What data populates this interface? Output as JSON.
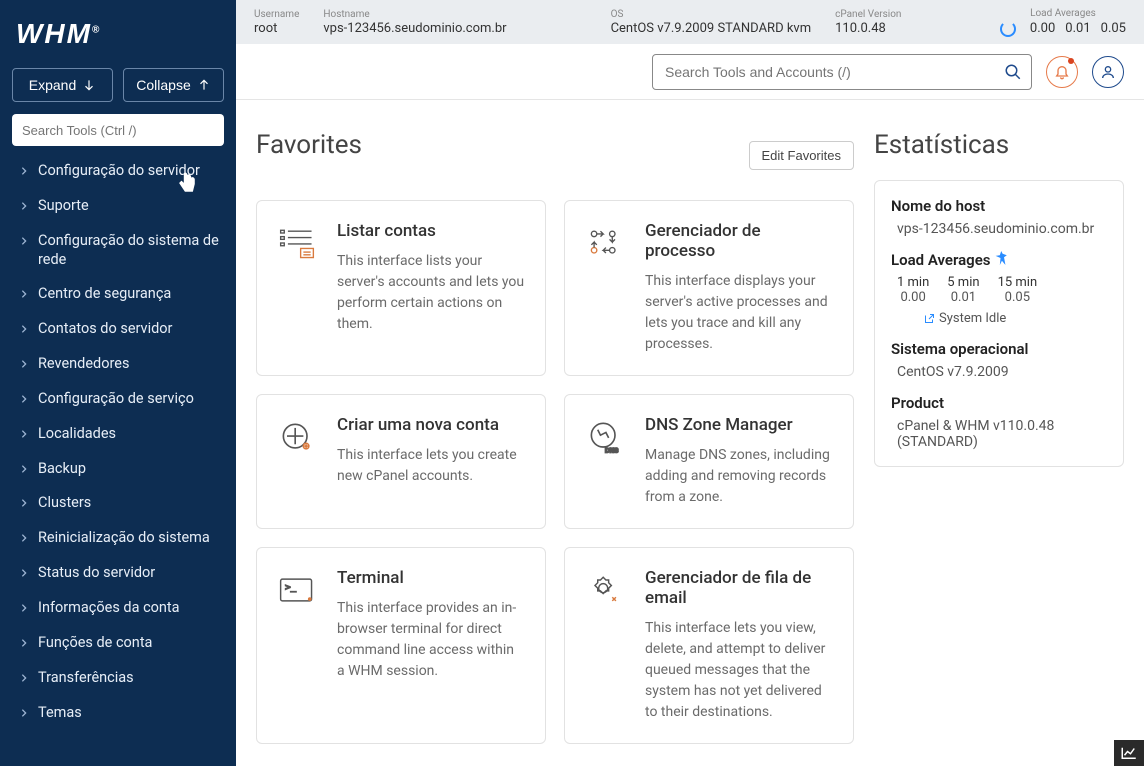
{
  "topbar": {
    "username_label": "Username",
    "username": "root",
    "hostname_label": "Hostname",
    "hostname": "vps-123456.seudominio.com.br",
    "os_label": "OS",
    "os": "CentOS v7.9.2009 STANDARD kvm",
    "cpanel_label": "cPanel Version",
    "cpanel_version": "110.0.48",
    "la_label": "Load Averages",
    "la_1": "0.00",
    "la_5": "0.01",
    "la_15": "0.05"
  },
  "search": {
    "placeholder": "Search Tools and Accounts (/)"
  },
  "sidebar": {
    "logo": "WHM",
    "expand": "Expand",
    "collapse": "Collapse",
    "search_placeholder": "Search Tools (Ctrl /)",
    "items": [
      "Configuração do servidor",
      "Suporte",
      "Configuração do sistema de rede",
      "Centro de segurança",
      "Contatos do servidor",
      "Revendedores",
      "Configuração de serviço",
      "Localidades",
      "Backup",
      "Clusters",
      "Reinicialização do sistema",
      "Status do servidor",
      "Informações da conta",
      "Funções de conta",
      "Transferências",
      "Temas"
    ]
  },
  "favorites": {
    "title": "Favorites",
    "edit": "Edit Favorites",
    "cards": [
      {
        "title": "Listar contas",
        "desc": "This interface lists your server's accounts and lets you perform certain actions on them."
      },
      {
        "title": "Gerenciador de processo",
        "desc": "This interface displays your server's active processes and lets you trace and kill any processes."
      },
      {
        "title": "Criar uma nova conta",
        "desc": "This interface lets you create new cPanel accounts."
      },
      {
        "title": "DNS Zone Manager",
        "desc": "Manage DNS zones, including adding and removing records from a zone."
      },
      {
        "title": "Terminal",
        "desc": "This interface provides an in-browser terminal for direct command line access within a WHM session."
      },
      {
        "title": "Gerenciador de fila de email",
        "desc": "This interface lets you view, delete, and attempt to deliver queued messages that the system has not yet delivered to their destinations."
      }
    ]
  },
  "stats": {
    "title": "Estatísticas",
    "hostname_label": "Nome do host",
    "hostname": "vps-123456.seudominio.com.br",
    "la_label": "Load Averages",
    "la_1h": "1 min",
    "la_5h": "5 min",
    "la_15h": "15 min",
    "la_1v": "0.00",
    "la_5v": "0.01",
    "la_15v": "0.05",
    "idle": "System Idle",
    "os_label": "Sistema operacional",
    "os": "CentOS v7.9.2009",
    "product_label": "Product",
    "product": "cPanel & WHM v110.0.48 (STANDARD)"
  }
}
